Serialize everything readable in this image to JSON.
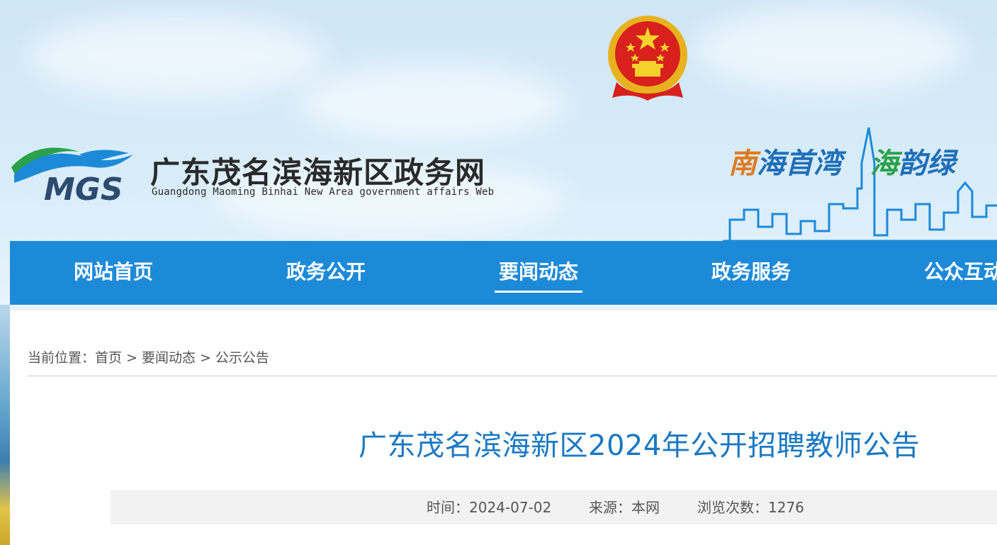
{
  "header": {
    "site_title": "广东茂名滨海新区政务网",
    "site_subtitle": "Guangdong Maoming Binhai New Area government affairs Web",
    "logo_text": "MGS",
    "slogan": {
      "part1": "南",
      "part2": "海首湾",
      "part3": "海",
      "part4": "韵绿"
    }
  },
  "nav": {
    "items": [
      {
        "label": "网站首页",
        "active": false
      },
      {
        "label": "政务公开",
        "active": false
      },
      {
        "label": "要闻动态",
        "active": true
      },
      {
        "label": "政务服务",
        "active": false
      },
      {
        "label": "公众互动",
        "active": false
      }
    ]
  },
  "breadcrumb": {
    "prefix": "当前位置：",
    "items": [
      "首页",
      "要闻动态",
      "公示公告"
    ],
    "separator": ">"
  },
  "article": {
    "title": "广东茂名滨海新区2024年公开招聘教师公告",
    "time": "时间：2024-07-02",
    "source": "来源：本网",
    "views": "浏览次数：1276"
  },
  "colors": {
    "nav_bg": "#1d8ad8",
    "title_color": "#1a78c2",
    "meta_bg": "#f2f2f2"
  }
}
